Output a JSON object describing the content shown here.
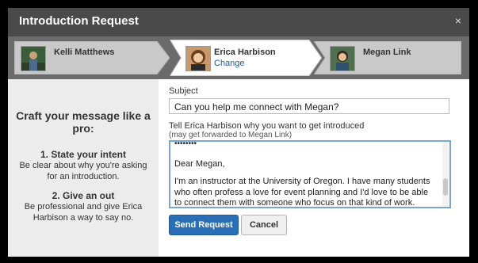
{
  "dialog": {
    "title": "Introduction Request",
    "close_glyph": "×"
  },
  "steps": [
    {
      "name": "Kelli Matthews",
      "icon": "avatar-photo"
    },
    {
      "name": "Erica Harbison",
      "link": "Change",
      "icon": "avatar-photo"
    },
    {
      "name": "Megan Link",
      "icon": "avatar-photo"
    }
  ],
  "tips": {
    "heading": "Craft your message like a pro:",
    "items": [
      {
        "title": "1. State your intent",
        "body": "Be clear about why you're asking for an introduction."
      },
      {
        "title": "2. Give an out",
        "body": "Be professional and give Erica Harbison a way to say no."
      }
    ]
  },
  "form": {
    "subject_label": "Subject",
    "subject_value": "Can you help me connect with Megan?",
    "message_label": "Tell Erica Harbison why you want to get introduced",
    "message_sublabel": "(may get forwarded to Megan Link)",
    "message_signature": "••••••••",
    "message_greeting": "Dear Megan,",
    "message_body": "I'm an instructor at the University of Oregon. I have many students who often profess a love for event planning and I'd love to be able to connect them with someone who focus on that kind of work. Would you be open to"
  },
  "buttons": {
    "send": "Send Request",
    "cancel": "Cancel"
  },
  "colors": {
    "titlebar": "#4a4a4a",
    "primary": "#2a6fb5",
    "link": "#1f5b99"
  }
}
